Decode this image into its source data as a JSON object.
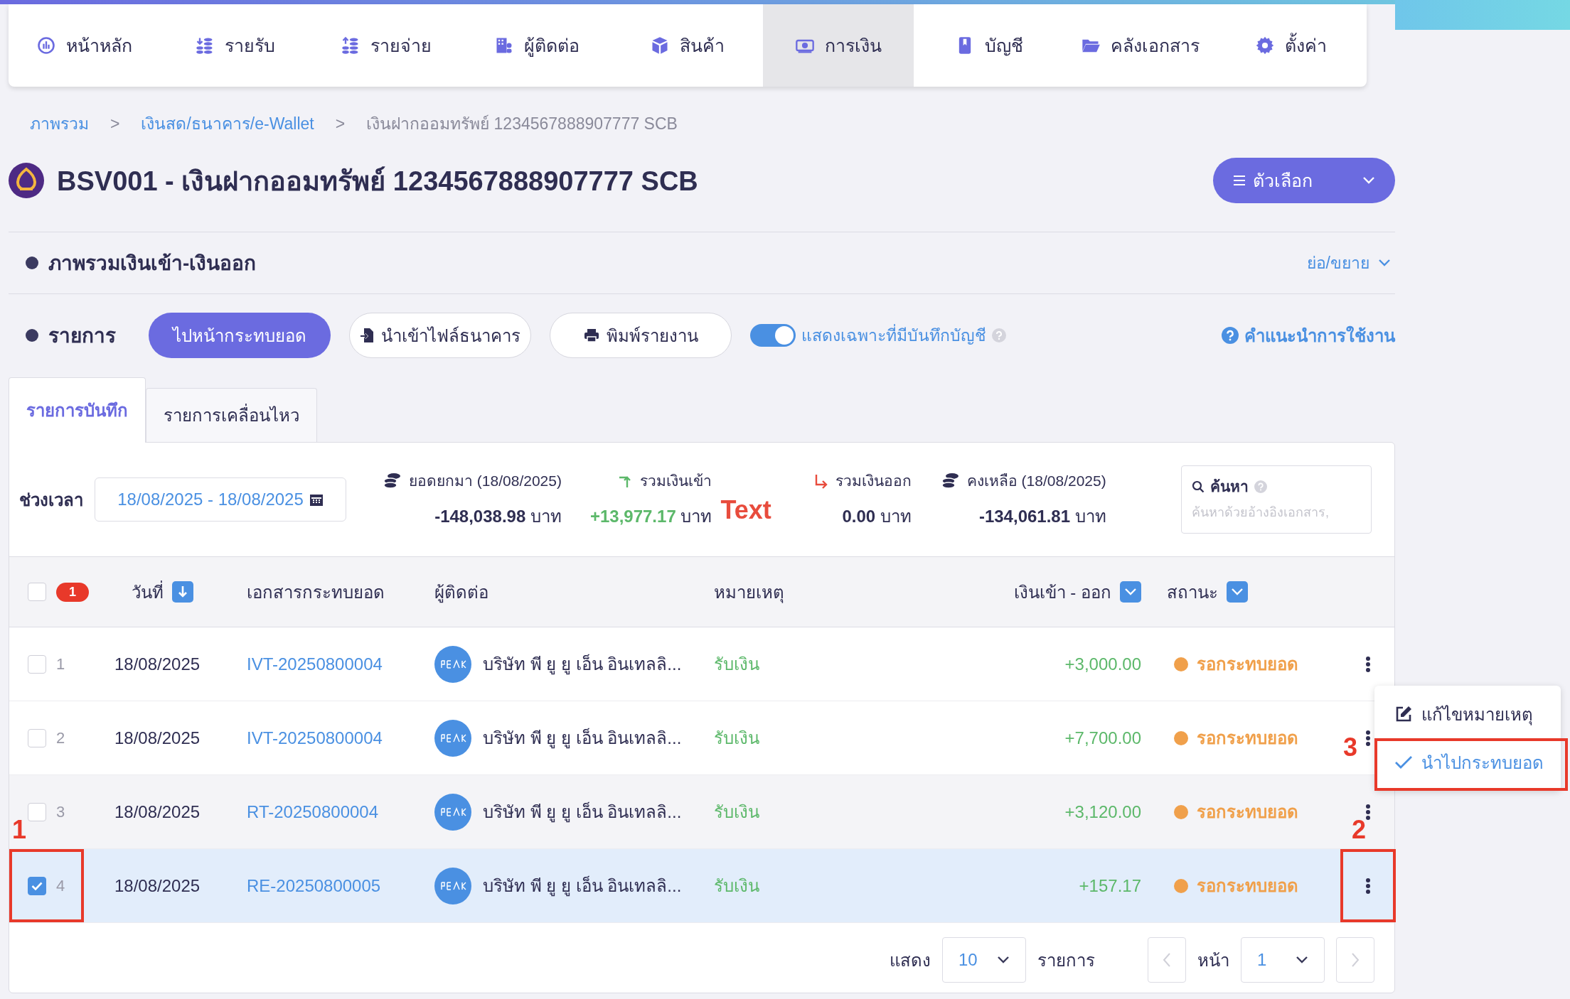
{
  "nav": [
    {
      "label": "หน้าหลัก",
      "kind": "dashboard",
      "selected": false
    },
    {
      "label": "รายรับ",
      "kind": "income",
      "selected": false
    },
    {
      "label": "รายจ่าย",
      "kind": "expense",
      "selected": false
    },
    {
      "label": "ผู้ติดต่อ",
      "kind": "contacts",
      "selected": false
    },
    {
      "label": "สินค้า",
      "kind": "product",
      "selected": false
    },
    {
      "label": "การเงิน",
      "kind": "money",
      "selected": true
    },
    {
      "label": "บัญชี",
      "kind": "book",
      "selected": false
    },
    {
      "label": "คลังเอกสาร",
      "kind": "folder",
      "selected": false
    },
    {
      "label": "ตั้งค่า",
      "kind": "gear",
      "selected": false
    }
  ],
  "breadcrumb": [
    {
      "label": "ภาพรวม",
      "link": true
    },
    {
      "label": "เงินสด/ธนาคาร/e-Wallet",
      "link": true
    },
    {
      "label": "เงินฝากออมทรัพย์ 1234567888907777 SCB",
      "link": false
    }
  ],
  "breadcrumb_separator": ">",
  "title": "BSV001 - เงินฝากออมทรัพย์ 1234567888907777 SCB",
  "options_button": "ตัวเลือก",
  "overview": {
    "title": "ภาพรวมเงินเข้า-เงินออก",
    "toggle": "ย่อ/ขยาย"
  },
  "toolbar": {
    "title": "รายการ",
    "reconcile_button": "ไปหน้ากระทบยอด",
    "import_button": "นำเข้าไฟล์ธนาคาร",
    "print_button": "พิมพ์รายงาน",
    "switch": {
      "label": "แสดงเฉพาะที่มีบันทึกบัญชี",
      "on": true
    },
    "help_link": "คำแนะนำการใช้งาน"
  },
  "tabs": [
    {
      "label": "รายการบันทึก",
      "selected": true
    },
    {
      "label": "รายการเคลื่อนไหว",
      "selected": false
    }
  ],
  "period": {
    "label": "ช่วงเวลา",
    "value": "18/08/2025 - 18/08/2025"
  },
  "summary": [
    {
      "kind": "coins",
      "label": "ยอดยกมา (18/08/2025)",
      "value": "-148,038.98",
      "unit": "บาท",
      "positive": false
    },
    {
      "kind": "in",
      "label": "รวมเงินเข้า",
      "value": "+13,977.17",
      "unit": "บาท",
      "positive": true
    },
    {
      "kind": "out",
      "label": "รวมเงินออก",
      "value": "0.00",
      "unit": "บาท",
      "positive": false
    },
    {
      "kind": "coins",
      "label": "คงเหลือ (18/08/2025)",
      "value": "-134,061.81",
      "unit": "บาท",
      "positive": false
    }
  ],
  "marker_text": "Text",
  "search": {
    "label": "ค้นหา",
    "placeholder": "ค้นหาด้วยอ้างอิงเอกสาร,"
  },
  "table": {
    "select_all_checked": false,
    "selected_count": "1",
    "columns": [
      "วันที่",
      "เอกสารกระทบยอด",
      "ผู้ติดต่อ",
      "หมายเหตุ",
      "เงินเข้า - ออก",
      "สถานะ"
    ],
    "rows": [
      {
        "checked": false,
        "hovered": false,
        "no": "1",
        "date": "18/08/2025",
        "doc": "IVT-20250800004",
        "contact": "บริษัท พี ยู ยู เอ็น อินเทลลิ...",
        "note": "รับเงิน",
        "amount": "+3,000.00",
        "status": "รอกระทบยอด",
        "color": "#f0a04b",
        "menu_open": false
      },
      {
        "checked": false,
        "hovered": false,
        "no": "2",
        "date": "18/08/2025",
        "doc": "IVT-20250800004",
        "contact": "บริษัท พี ยู ยู เอ็น อินเทลลิ...",
        "note": "รับเงิน",
        "amount": "+7,700.00",
        "status": "รอกระทบยอด",
        "color": "#f0a04b",
        "menu_open": true
      },
      {
        "checked": false,
        "hovered": true,
        "no": "3",
        "date": "18/08/2025",
        "doc": "RT-20250800004",
        "contact": "บริษัท พี ยู ยู เอ็น อินเทลลิ...",
        "note": "รับเงิน",
        "amount": "+3,120.00",
        "status": "รอกระทบยอด",
        "color": "#f0a04b",
        "menu_open": false
      },
      {
        "checked": true,
        "hovered": false,
        "no": "4",
        "date": "18/08/2025",
        "doc": "RE-20250800005",
        "contact": "บริษัท พี ยู ยู เอ็น อินเทลลิ...",
        "note": "รับเงิน",
        "amount": "+157.17",
        "status": "รอกระทบยอด",
        "color": "#f0a04b",
        "menu_open": false,
        "check_annotation": "1",
        "menu_annotation": "2"
      }
    ]
  },
  "context_menu": [
    {
      "kind": "edit",
      "label": "แก้ไขหมายเหตุ",
      "selected": false
    },
    {
      "kind": "check",
      "label": "นำไปกระทบยอด",
      "selected": true,
      "annotation": "3"
    }
  ],
  "pagination": {
    "show_label": "แสดง",
    "page_size": "10",
    "rows_label": "รายการ",
    "page_label": "หน้า",
    "page": "1",
    "prev_disabled": true,
    "next_disabled": true
  }
}
